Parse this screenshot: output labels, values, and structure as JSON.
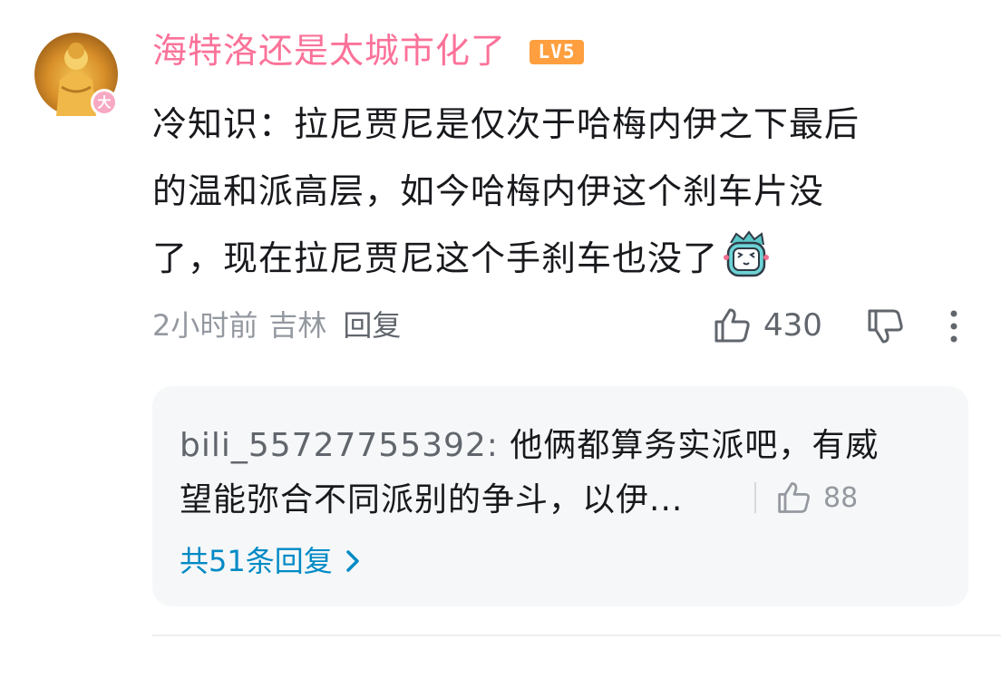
{
  "comment": {
    "username": "海特洛还是太城市化了",
    "level": "LV5",
    "avatar_badge": "大",
    "text_lines": [
      "冷知识：拉尼贾尼是仅次于哈梅内伊之下最后",
      "的温和派高层，如今哈梅内伊这个刹车片没",
      "了，现在拉尼贾尼这个手刹车也没了"
    ],
    "time": "2小时前",
    "location": "吉林",
    "reply_label": "回复",
    "like_count": "430"
  },
  "reply": {
    "user": "bili_55727755392:",
    "text_line1": " 他俩都算务实派吧，有威",
    "text_line2": "望能弥合不同派别的争斗，以伊...",
    "like_count": "88",
    "total_replies": "共51条回复"
  },
  "colors": {
    "username": "#fb7299",
    "level_badge": "#ff9f3f",
    "reply_link": "#008ac5",
    "muted": "#9499a0"
  },
  "icons": [
    "thumb-up-icon",
    "thumb-down-icon",
    "more-vertical-icon",
    "chevron-right-icon",
    "sticker-emoji-icon"
  ]
}
